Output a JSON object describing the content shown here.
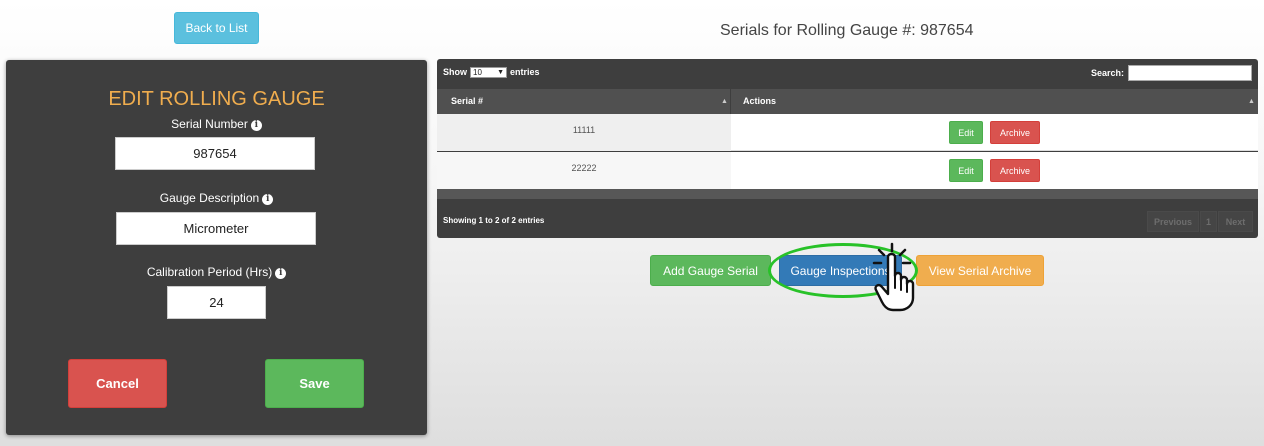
{
  "header": {
    "back_label": "Back to List",
    "title": "Serials for Rolling Gauge #: 987654"
  },
  "edit_form": {
    "title": "EDIT ROLLING GAUGE",
    "info_glyph": "i",
    "fields": [
      {
        "label": "Serial Number",
        "value": "987654"
      },
      {
        "label": "Gauge Description",
        "value": "Micrometer"
      },
      {
        "label": "Calibration Period (Hrs)",
        "value": "24"
      }
    ],
    "cancel_label": "Cancel",
    "save_label": "Save"
  },
  "table": {
    "show_label": "Show",
    "page_length": "10",
    "entries_label": "entries",
    "search_label": "Search:",
    "search_value": "",
    "columns": [
      "Serial #",
      "Actions"
    ],
    "rows": [
      {
        "serial": "11111",
        "edit_label": "Edit",
        "archive_label": "Archive"
      },
      {
        "serial": "22222",
        "edit_label": "Edit",
        "archive_label": "Archive"
      }
    ],
    "info": "Showing 1 to 2 of 2 entries",
    "pagination": {
      "previous": "Previous",
      "page": "1",
      "next": "Next"
    }
  },
  "actions": {
    "add_serial_label": "Add Gauge Serial",
    "inspections_label": "Gauge Inspections",
    "view_archive_label": "View Serial Archive"
  },
  "colors": {
    "panel_bg": "#3e3e3e",
    "title_accent": "#f0ad4e",
    "info_btn": "#5bc0de",
    "success": "#5cb85c",
    "danger": "#d9534f",
    "primary": "#337ab7",
    "warning": "#f0ad4e",
    "highlight_ring": "#28c228"
  },
  "icons": {
    "info": "info-circle-icon",
    "sort": "sort-caret-icon",
    "select_caret": "caret-down-icon",
    "pointer": "hand-pointer-icon"
  }
}
